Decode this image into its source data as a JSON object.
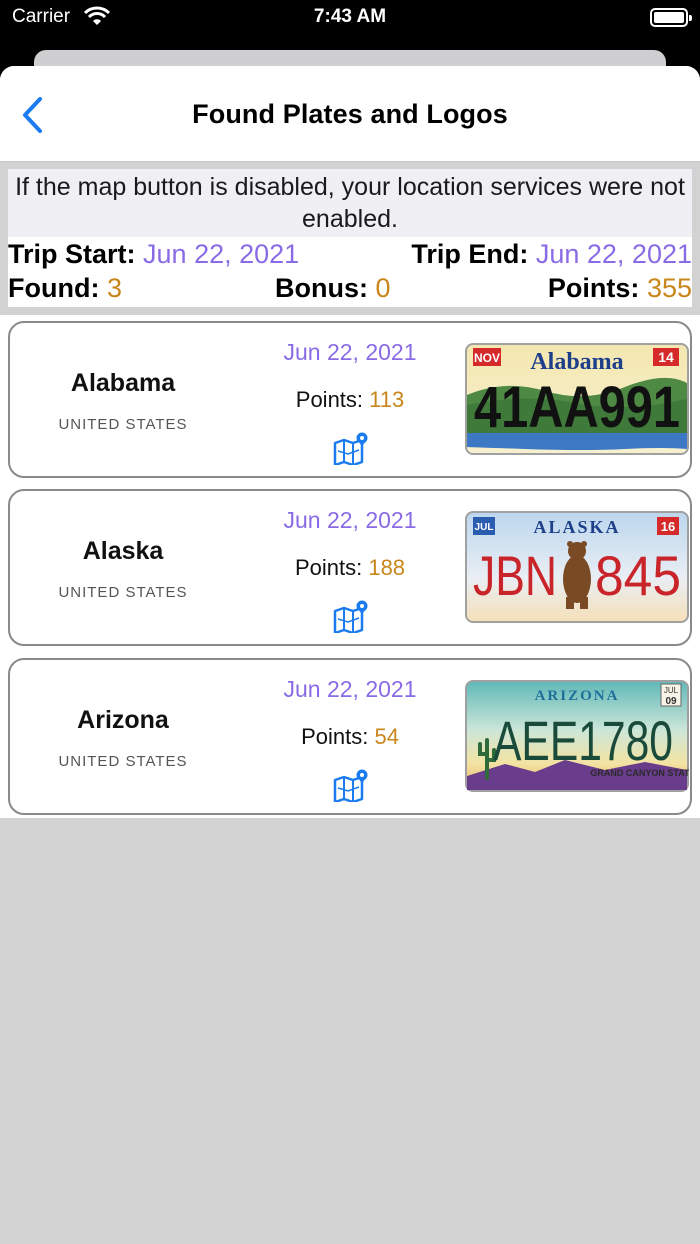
{
  "status_bar": {
    "carrier": "Carrier",
    "time": "7:43 AM"
  },
  "nav": {
    "title": "Found Plates and Logos",
    "back_icon": "chevron-left-icon"
  },
  "notice": "If the map button is disabled, your location services were not enabled.",
  "trip": {
    "start_label": "Trip Start:",
    "start_value": "Jun 22, 2021",
    "end_label": "Trip End:",
    "end_value": "Jun 22, 2021",
    "found_label": "Found:",
    "found_value": "3",
    "bonus_label": "Bonus:",
    "bonus_value": "0",
    "points_label": "Points:",
    "points_value": "355"
  },
  "colors": {
    "accent_blue": "#1a7cf0",
    "date_purple": "#8a6be6",
    "value_orange": "#c9861a"
  },
  "plates": [
    {
      "name": "Alabama",
      "country": "UNITED STATES",
      "date": "Jun 22, 2021",
      "points_label": "Points:",
      "points": "113",
      "map_icon": "map-pin-icon",
      "plate": {
        "header": "Alabama",
        "number": "41AA991",
        "month": "NOV",
        "year": "14"
      }
    },
    {
      "name": "Alaska",
      "country": "UNITED STATES",
      "date": "Jun 22, 2021",
      "points_label": "Points:",
      "points": "188",
      "map_icon": "map-pin-icon",
      "plate": {
        "header": "ALASKA",
        "number_left": "JBN",
        "number_right": "845",
        "month": "JUL",
        "year": "16"
      }
    },
    {
      "name": "Arizona",
      "country": "UNITED STATES",
      "date": "Jun 22, 2021",
      "points_label": "Points:",
      "points": "54",
      "map_icon": "map-pin-icon",
      "plate": {
        "header": "ARIZONA",
        "number": "AEE1780",
        "footer": "GRAND CANYON STATE",
        "month": "JUL",
        "year": "09"
      }
    }
  ]
}
